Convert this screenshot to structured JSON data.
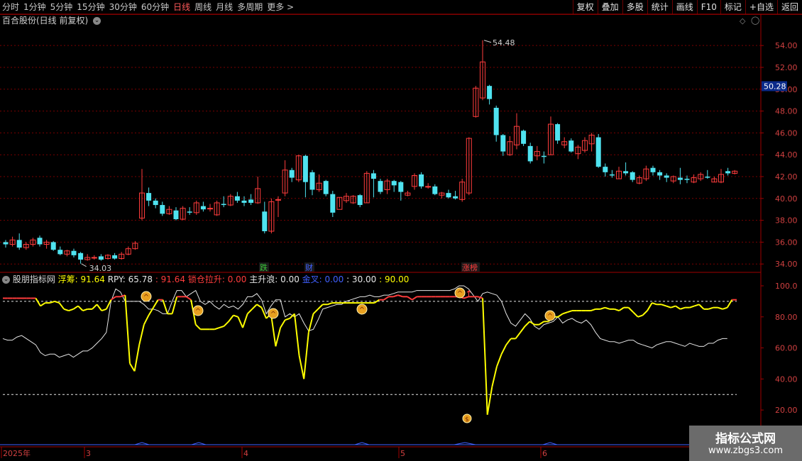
{
  "toolbar": {
    "periods": [
      "分时",
      "1分钟",
      "5分钟",
      "15分钟",
      "30分钟",
      "60分钟",
      "日线",
      "周线",
      "月线",
      "多周期",
      "更多 >"
    ],
    "active_period": "日线",
    "right_buttons": [
      "复权",
      "叠加",
      "多股",
      "统计",
      "画线",
      "F10",
      "标记",
      "+自选",
      "返回"
    ]
  },
  "chart_title": "百合股份(日线 前复权)",
  "colors": {
    "up": "#ff3c3c",
    "down": "#4fe3f0",
    "grid": "#7a0000",
    "axis": "#a00000",
    "yellow": "#ffff00",
    "white": "#e6e6e6",
    "blue": "#4060ff"
  },
  "price_axis": {
    "ticks": [
      "54.00",
      "52.00",
      "50.00",
      "48.00",
      "46.00",
      "44.00",
      "42.00",
      "40.00",
      "38.00",
      "36.00",
      "34.00"
    ],
    "current_price": "50.28"
  },
  "annotations": {
    "high": "54.48",
    "low": "34.03"
  },
  "event_markers": [
    "跌",
    "财",
    "涨榜"
  ],
  "indicator": {
    "name": "股朋指标网",
    "float_label": "浮筹: 91.64",
    "rpy_label": "RPY: 65.78",
    "lock_label": ": 91.64",
    "lock_rise_label": "锁仓拉升: 0.00",
    "main_wave_label": "主升浪: 0.00",
    "gold_cross_label": "金叉: 0.00",
    "level30_label": ": 30.00",
    "level90_label": ": 90.00",
    "axis_ticks": [
      "100.0",
      "80.00",
      "60.00",
      "40.00",
      "20.00"
    ]
  },
  "time_axis": {
    "labels": [
      "2025年",
      "3",
      "4",
      "5",
      "6"
    ]
  },
  "watermark": {
    "line1": "指标公式网",
    "line2": "www.zbgs3.com"
  },
  "chart_data": {
    "type": "candlestick",
    "ylim": [
      33.3,
      55.7
    ],
    "candles": [
      [
        36,
        35.8,
        36.2,
        35.5
      ],
      [
        35.8,
        36.2,
        36.5,
        35.6
      ],
      [
        36.2,
        35.5,
        36.8,
        35.3
      ],
      [
        35.5,
        35.8,
        36,
        35.3
      ],
      [
        35.8,
        36.2,
        36.4,
        35.6
      ],
      [
        36.4,
        35.8,
        36.6,
        35.6
      ],
      [
        35.8,
        36,
        36.2,
        35.4
      ],
      [
        36,
        35.3,
        36.1,
        35.2
      ],
      [
        35.3,
        34.9,
        35.6,
        34.8
      ],
      [
        34.9,
        35.2,
        35.3,
        34.7
      ],
      [
        35.2,
        34.8,
        35.4,
        34.6
      ],
      [
        35,
        34.4,
        35.1,
        34.03
      ],
      [
        34.4,
        34.6,
        34.9,
        34.3
      ],
      [
        34.6,
        34.6,
        34.8,
        34.4
      ],
      [
        34.7,
        34.4,
        34.9,
        34.3
      ],
      [
        34.5,
        34.8,
        34.9,
        34.4
      ],
      [
        34.8,
        34.5,
        35,
        34.4
      ],
      [
        34.5,
        34.9,
        35.1,
        34.4
      ],
      [
        34.9,
        35.4,
        35.6,
        34.8
      ],
      [
        35.4,
        35.9,
        36.1,
        35.3
      ],
      [
        38.2,
        40.5,
        42.7,
        38
      ],
      [
        40.5,
        39.8,
        41,
        39.3
      ],
      [
        39.8,
        39.4,
        40,
        39.1
      ],
      [
        39.4,
        38.6,
        39.7,
        38.4
      ],
      [
        38.6,
        39,
        39.3,
        38.5
      ],
      [
        38.9,
        38.1,
        39.2,
        38
      ],
      [
        38.1,
        39.1,
        39.3,
        38
      ],
      [
        38.8,
        38.7,
        39.2,
        38.5
      ],
      [
        38.7,
        39.6,
        39.8,
        38.5
      ],
      [
        39.3,
        39,
        39.7,
        38.8
      ],
      [
        39.1,
        39.1,
        39.5,
        38.8
      ],
      [
        38.5,
        39.6,
        39.8,
        38.4
      ],
      [
        39.5,
        39.4,
        40.2,
        39.2
      ],
      [
        39.4,
        40.2,
        40.4,
        39.3
      ],
      [
        40.2,
        39.8,
        40.6,
        39.6
      ],
      [
        39.8,
        39.6,
        40.2,
        39.3
      ],
      [
        39.9,
        39.6,
        40.4,
        39.4
      ],
      [
        39.6,
        40.9,
        42,
        39.5
      ],
      [
        38.8,
        37,
        39.7,
        36.8
      ],
      [
        37,
        39.7,
        40,
        36.8
      ],
      [
        39.9,
        39.9,
        40.2,
        38.3
      ],
      [
        40.5,
        42.6,
        43.5,
        40.2
      ],
      [
        42.6,
        41.9,
        42.8,
        41.5
      ],
      [
        41.7,
        43.9,
        44,
        41.5
      ],
      [
        43.9,
        41.5,
        44,
        40.1
      ],
      [
        42.4,
        40.8,
        42.6,
        40.3
      ],
      [
        40.8,
        41.4,
        42.2,
        40.6
      ],
      [
        41.6,
        40.4,
        41.7,
        40.2
      ],
      [
        40.4,
        38.7,
        40.7,
        38.3
      ],
      [
        39,
        40.1,
        40.1,
        39.2
      ],
      [
        39.8,
        40.2,
        40.5,
        39.6
      ],
      [
        39.6,
        40.2,
        40.3,
        39.5
      ],
      [
        40.3,
        39.4,
        40.4,
        39.2
      ],
      [
        39.6,
        42.3,
        42.5,
        39.6
      ],
      [
        42.3,
        41.8,
        42.6,
        40.1
      ],
      [
        41.6,
        40.6,
        41.8,
        40.4
      ],
      [
        40.8,
        41.6,
        41.8,
        40.4
      ],
      [
        41.6,
        41.2,
        41.7,
        40.6
      ],
      [
        41.5,
        40.6,
        41.6,
        39.8
      ],
      [
        40.3,
        40.5,
        40.7,
        40.2
      ],
      [
        41.1,
        42.1,
        42.3,
        40.8
      ],
      [
        42.2,
        41.1,
        42.4,
        40.9
      ],
      [
        41.1,
        41.1,
        41.4,
        40.9
      ],
      [
        41.1,
        40.4,
        41.3,
        40.3
      ],
      [
        40.3,
        40.5,
        40.6,
        40
      ],
      [
        40.5,
        40.1,
        40.8,
        40
      ],
      [
        40.2,
        40,
        40.7,
        39.9
      ],
      [
        39.9,
        41.5,
        41.8,
        39.7
      ],
      [
        40.5,
        45.5,
        45.6,
        40.3
      ],
      [
        47.5,
        50.1,
        50.3,
        47.4
      ],
      [
        49.2,
        52.5,
        54.48,
        49
      ],
      [
        50.3,
        49.1,
        50.4,
        48.6
      ],
      [
        48.3,
        45.8,
        48.5,
        45.2
      ],
      [
        45.8,
        44.3,
        45.9,
        43.9
      ],
      [
        44,
        45.2,
        45.7,
        43.9
      ],
      [
        44.9,
        46.6,
        47.8,
        44.5
      ],
      [
        46.2,
        45,
        46.3,
        44.8
      ],
      [
        44.8,
        43.4,
        45.1,
        43.2
      ],
      [
        43.9,
        44.3,
        44.8,
        43.5
      ],
      [
        43.9,
        43.8,
        44.3,
        43.2
      ],
      [
        44,
        46.8,
        47.5,
        44
      ],
      [
        46.8,
        45.3,
        46.9,
        45
      ],
      [
        44.9,
        45.2,
        45.6,
        44.6
      ],
      [
        45.3,
        44.3,
        45.5,
        44.2
      ],
      [
        44.1,
        44.7,
        44.9,
        43.6
      ],
      [
        44.4,
        45.3,
        45.6,
        44.2
      ],
      [
        45,
        45.8,
        46,
        44.3
      ],
      [
        45.6,
        42.9,
        45.9,
        42.8
      ],
      [
        42.9,
        42.4,
        43.2,
        42
      ],
      [
        42.2,
        42.1,
        42.6,
        41.9
      ],
      [
        41.8,
        42.5,
        42.9,
        41.8
      ],
      [
        42.5,
        42.3,
        43.3,
        42.1
      ],
      [
        42.4,
        41.7,
        42.5,
        41.5
      ],
      [
        41.4,
        41.9,
        42.1,
        41.3
      ],
      [
        41.8,
        42.7,
        43,
        41.6
      ],
      [
        42.8,
        42.4,
        43,
        42.1
      ],
      [
        42.4,
        42.1,
        42.6,
        41.7
      ],
      [
        42.1,
        41.9,
        42.3,
        41.5
      ],
      [
        41.6,
        42,
        42.1,
        41.4
      ],
      [
        41.9,
        41.7,
        42.8,
        41.3
      ],
      [
        41.8,
        41.7,
        42.1,
        41.4
      ],
      [
        41.5,
        41.9,
        42.2,
        41.4
      ],
      [
        41.8,
        42.2,
        42.4,
        41.6
      ],
      [
        42,
        41.9,
        42.6,
        41.8
      ],
      [
        41.5,
        41.8,
        42,
        41.5
      ],
      [
        41.5,
        42.2,
        42.7,
        41.4
      ],
      [
        42.5,
        42.3,
        42.8,
        42.1
      ],
      [
        42.3,
        42.5,
        42.6,
        42.2
      ]
    ],
    "indicator_series": [
      {
        "name": "浮筹",
        "values": [
          92,
          92,
          92,
          92,
          92,
          92,
          92,
          92,
          87,
          89,
          89,
          90,
          89,
          85,
          84,
          85,
          87,
          84,
          85,
          85,
          88,
          84,
          85,
          91,
          93,
          93,
          94,
          50,
          45,
          62,
          75,
          81,
          86,
          91,
          91,
          82,
          82,
          93,
          93,
          93,
          91,
          75,
          72,
          72,
          72,
          72,
          73,
          74,
          77,
          81,
          80,
          73,
          82,
          85,
          88,
          86,
          79,
          82,
          61,
          73,
          78,
          79,
          82,
          55,
          40,
          70,
          82,
          85,
          88,
          88,
          89,
          89,
          89,
          89,
          89,
          89,
          89,
          89,
          89,
          89,
          91,
          91,
          93,
          93,
          94,
          93,
          93,
          91,
          93,
          93,
          93,
          93,
          93,
          93,
          93,
          93,
          93,
          93,
          92,
          93,
          93,
          93,
          92,
          17,
          35,
          48,
          56,
          62,
          66,
          66,
          70,
          74,
          77,
          75,
          75,
          77,
          77,
          80,
          80,
          82,
          83,
          84,
          84,
          84,
          84,
          84,
          85,
          85,
          86,
          85,
          85,
          84,
          86,
          86,
          83,
          80,
          81,
          84,
          89,
          88,
          88,
          87,
          86,
          87,
          85,
          86,
          86,
          87,
          88,
          85,
          85,
          86,
          86,
          85,
          86,
          91,
          91
        ]
      },
      {
        "name": "RPY",
        "values": [
          66,
          65,
          65,
          67,
          68,
          66,
          64,
          62,
          57,
          55,
          56,
          56,
          54,
          55,
          56,
          54,
          56,
          58,
          58,
          60,
          63,
          66,
          70,
          90,
          98,
          96,
          90,
          90,
          90,
          90,
          88,
          85,
          85,
          84,
          82,
          82,
          90,
          97,
          97,
          93,
          95,
          97,
          90,
          88,
          90,
          87,
          85,
          88,
          86,
          87,
          85,
          88,
          93,
          93,
          95,
          91,
          82,
          87,
          91,
          91,
          80,
          82,
          80,
          82,
          76,
          71,
          72,
          78,
          85,
          86,
          87,
          88,
          88,
          90,
          91,
          92,
          93,
          93,
          94,
          93,
          93,
          94,
          94,
          95,
          96,
          96,
          96,
          96,
          97,
          97,
          97,
          97,
          97,
          97,
          97,
          97,
          98,
          100,
          100,
          98,
          94,
          90,
          95,
          96,
          95,
          94,
          90,
          82,
          76,
          74,
          78,
          82,
          79,
          74,
          72,
          75,
          76,
          77,
          80,
          76,
          78,
          79,
          77,
          76,
          78,
          75,
          70,
          66,
          65,
          64,
          64,
          63,
          64,
          65,
          65,
          63,
          62,
          61,
          60,
          62,
          63,
          64,
          64,
          63,
          62,
          61,
          63,
          62,
          61,
          61,
          63,
          63,
          65,
          66,
          66
        ]
      }
    ]
  }
}
